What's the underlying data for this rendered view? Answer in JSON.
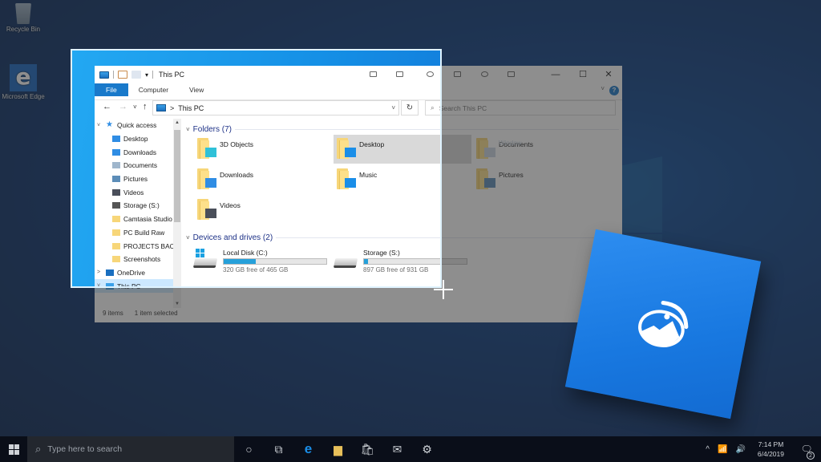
{
  "desktop": {
    "icons": [
      {
        "label": "Recycle Bin",
        "icon": "recycle-bin-icon"
      },
      {
        "label": "Microsoft Edge",
        "icon": "edge-icon",
        "glyph": "e"
      }
    ]
  },
  "explorer": {
    "title": "This PC",
    "ribbon_tabs": [
      "File",
      "Computer",
      "View"
    ],
    "help": "?",
    "address": {
      "crumb": "This PC",
      "separator": ">"
    },
    "search_placeholder": "Search This PC",
    "window_controls": {
      "minimize": "—",
      "maximize": "☐",
      "close": "✕"
    },
    "nav_buttons": {
      "back": "←",
      "forward": "→",
      "recent": "˅",
      "up": "↑",
      "refresh": "↻",
      "dropdown": "˅"
    },
    "nav_pane": [
      {
        "label": "Quick access",
        "type": "header",
        "expander": "˅"
      },
      {
        "label": "Desktop",
        "pinned": true,
        "color": "#2f8de4"
      },
      {
        "label": "Downloads",
        "pinned": true,
        "color": "#2f8de4"
      },
      {
        "label": "Documents",
        "pinned": true,
        "color": "#9fb6cc"
      },
      {
        "label": "Pictures",
        "pinned": true,
        "color": "#5c8db8"
      },
      {
        "label": "Videos",
        "pinned": true,
        "color": "#4a4f5a"
      },
      {
        "label": "Storage (S:)",
        "pinned": true,
        "color": "#555555"
      },
      {
        "label": "Camtasia Studio",
        "pinned": false,
        "color": "#f7d679"
      },
      {
        "label": "PC Build Raw",
        "pinned": false,
        "color": "#f7d679"
      },
      {
        "label": "PROJECTS BACK",
        "pinned": false,
        "color": "#f7d679"
      },
      {
        "label": "Screenshots",
        "pinned": false,
        "color": "#f7d679"
      },
      {
        "label": "OneDrive",
        "type": "header",
        "expander": ">",
        "color": "#1a6fc0"
      },
      {
        "label": "This PC",
        "type": "header",
        "expander": "˅",
        "selected": true,
        "color": "#3aa0e8"
      }
    ],
    "pin_glyph": "📌",
    "folders_header": "Folders (7)",
    "folders": [
      {
        "label": "3D Objects",
        "badge_color": "#2fc1d8"
      },
      {
        "label": "Desktop",
        "badge_color": "#1a8ee8",
        "selected": true
      },
      {
        "label": "Documents",
        "badge_color": "#c9d6e3"
      },
      {
        "label": "Downloads",
        "badge_color": "#2f8de4"
      },
      {
        "label": "Music",
        "badge_color": "#1a8ee8"
      },
      {
        "label": "Pictures",
        "badge_color": "#5c8db8"
      },
      {
        "label": "Videos",
        "badge_color": "#4a4f5a"
      }
    ],
    "drives_header": "Devices and drives (2)",
    "drives": [
      {
        "label": "Local Disk (C:)",
        "free": "320 GB free of 465 GB",
        "used_fraction": 0.312,
        "system": true
      },
      {
        "label": "Storage (S:)",
        "free": "897 GB free of 931 GB",
        "used_fraction": 0.037,
        "system": false
      }
    ],
    "status": {
      "items": "9 items",
      "selected": "1 item selected"
    },
    "watermark": "Window"
  },
  "snip_overlay": {
    "tool": "Snip & Sketch",
    "icon": "snip-sketch-icon"
  },
  "taskbar": {
    "search_placeholder": "Type here to search",
    "apps": [
      {
        "name": "cortana",
        "glyph": "○"
      },
      {
        "name": "task-view",
        "glyph": "⧉"
      },
      {
        "name": "edge",
        "glyph": "e",
        "color": "#1a8ee8"
      },
      {
        "name": "file-explorer",
        "glyph": "▆",
        "color": "#e8c05a"
      },
      {
        "name": "store",
        "glyph": "🛍",
        "color": "#cfd3d8"
      },
      {
        "name": "mail",
        "glyph": "✉",
        "color": "#cfd3d8"
      },
      {
        "name": "settings",
        "glyph": "⚙",
        "color": "#cfd3d8"
      }
    ],
    "tray": {
      "chevron": "^",
      "network": "📶",
      "volume": "🔊",
      "time": "7:14 PM",
      "date": "6/4/2019",
      "notifications": "2",
      "action_center_glyph": "🗨"
    }
  }
}
